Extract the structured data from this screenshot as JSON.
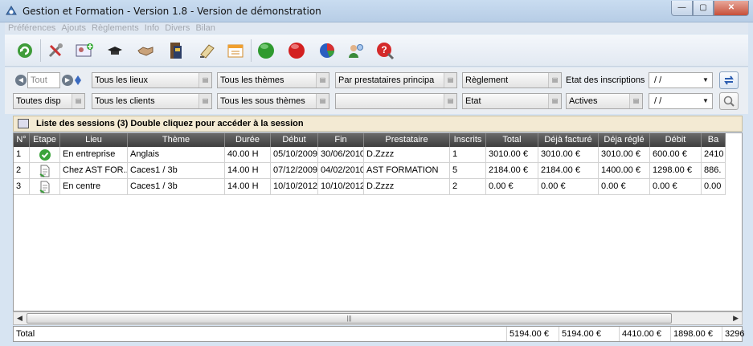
{
  "window": {
    "title": "Gestion et Formation - Version 1.8  - Version de démonstration",
    "minimize_label": "—",
    "maximize_label": "▢",
    "close_label": "✕"
  },
  "menu": [
    "Préférences",
    "Ajouts",
    "Règlements",
    "Info",
    "Divers",
    "Bilan"
  ],
  "toolbar": {
    "icons": [
      "refresh-icon",
      "tools-icon",
      "add-contact-icon",
      "graduation-cap-icon",
      "handshake-icon",
      "document-stack-icon",
      "notepad-icon",
      "calendar-icon",
      "green-circle-icon",
      "red-circle-icon",
      "pie-chart-icon",
      "users-icon",
      "help-icon"
    ]
  },
  "filters": {
    "row1": {
      "period_value": "Tout",
      "lieux": "Tous les lieux",
      "themes": "Tous les thèmes",
      "prestataires": "Par prestataires principa",
      "reglement": "Règlement",
      "etat_inscriptions_label": "Etat des inscriptions",
      "date1": " / /"
    },
    "row2": {
      "dispo": "Toutes disp",
      "clients": "Tous les clients",
      "sous_themes": "Tous les sous thèmes",
      "empty_combo": "",
      "etat": "Etat",
      "actives": "Actives",
      "date2": " / /"
    }
  },
  "sessions": {
    "header": "Liste des sessions (3) Double cliquez pour accéder à la session",
    "columns": [
      "N°",
      "Etape",
      "Lieu",
      "Thème",
      "Durée",
      "Début",
      "Fin",
      "Prestataire",
      "Inscrits",
      "Total",
      "Déjà facturé",
      "Déja réglé",
      "Débit",
      "Ba"
    ],
    "rows": [
      {
        "num": "1",
        "etape_icon": "check-icon",
        "lieu": "En entreprise",
        "theme": "Anglais",
        "duree": "40.00 H",
        "debut": "05/10/2009",
        "fin": "30/06/2010",
        "prestataire": "D.Zzzz",
        "inscrits": "1",
        "total": "3010.00 €",
        "facture": "3010.00 €",
        "regle": "3010.00 €",
        "debit": "600.00 €",
        "ba": "2410"
      },
      {
        "num": "2",
        "etape_icon": "document-icon",
        "lieu": "Chez AST FOR...",
        "theme": "Caces1 / 3b",
        "duree": "14.00 H",
        "debut": "07/12/2009",
        "fin": "04/02/2010",
        "prestataire": "AST FORMATION",
        "inscrits": "5",
        "total": "2184.00 €",
        "facture": "2184.00 €",
        "regle": "1400.00 €",
        "debit": "1298.00 €",
        "ba": "886."
      },
      {
        "num": "3",
        "etape_icon": "document-icon",
        "lieu": "En centre",
        "theme": "Caces1 / 3b",
        "duree": "14.00 H",
        "debut": "10/10/2012",
        "fin": "10/10/2012",
        "prestataire": "D.Zzzz",
        "inscrits": "2",
        "total": "0.00 €",
        "facture": "0.00 €",
        "regle": "0.00 €",
        "debit": "0.00 €",
        "ba": "0.00"
      }
    ],
    "totals": {
      "label": "Total",
      "total": "5194.00 €",
      "facture": "5194.00 €",
      "regle": "4410.00 €",
      "debit": "1898.00 €",
      "ba": "3296"
    }
  },
  "scrollbar": {
    "left_arrow": "◀",
    "right_arrow": "▶",
    "grip": "|||"
  }
}
